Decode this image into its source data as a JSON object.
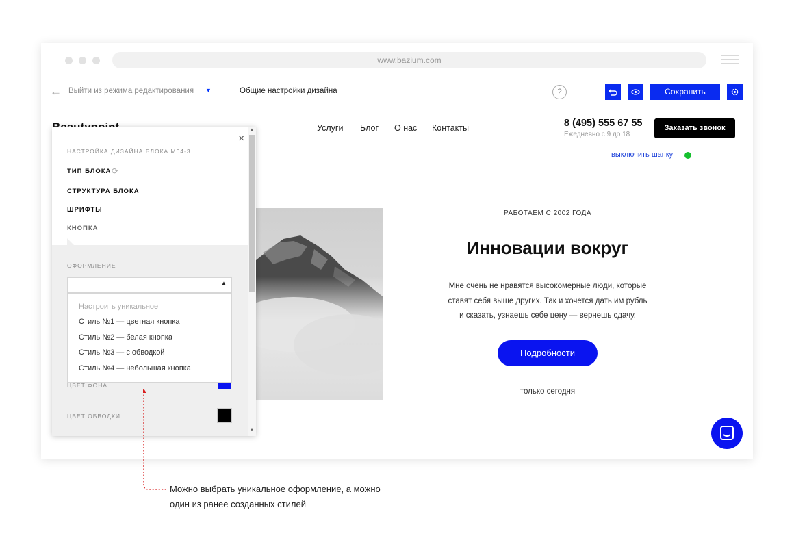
{
  "browser": {
    "url": "www.bazium.com"
  },
  "toolbar": {
    "exit_label": "Выйти из режима редактирования",
    "design_settings_label": "Общие настройки дизайна",
    "help_label": "?",
    "save_label": "Сохранить",
    "accent_color": "#0a2bf0"
  },
  "site_header": {
    "logo": "Beautypoint",
    "nav": [
      "Услуги",
      "Блог",
      "О нас",
      "Контакты"
    ],
    "phone": "8 (495) 555 67 55",
    "hours": "Ежедневно с 9 до 18",
    "call_button": "Заказать звонок",
    "disable_header_link": "выключить шапку"
  },
  "hero": {
    "since": "РАБОТАЕМ С 2002 ГОДА",
    "title": "Инновации вокруг",
    "text_line1": "Мне очень не нравятся высокомерные люди, которые",
    "text_line2": "ставят себя выше других. Так и хочется дать им рубль",
    "text_line3": "и сказать, узнаешь себе цену — вернешь сдачу.",
    "button": "Подробности",
    "only_today": "только сегодня",
    "button_color": "#0a14f0"
  },
  "panel": {
    "title": "НАСТРОЙКА ДИЗАЙНА БЛОКА M04-3",
    "items": [
      "ТИП БЛОКА",
      "СТРУКТУРА БЛОКА",
      "ШРИФТЫ",
      "КНОПКА"
    ],
    "appearance_label": "ОФОРМЛЕНИЕ",
    "dropdown": {
      "placeholder": "Настроить уникальное",
      "options": [
        "Стиль №1 — цветная кнопка",
        "Стиль №2 — белая кнопка",
        "Стиль №3 — с обводкой",
        "Стиль №4 — небольшая кнопка"
      ]
    },
    "bg_color_label": "ЦВЕТ ФОНА",
    "bg_color": "#0a14f0",
    "border_color_label": "ЦВЕТ ОБВОДКИ",
    "border_color": "#000000"
  },
  "annotation": {
    "line1": "Можно выбрать уникальное оформление, а можно",
    "line2": "один из ранее созданных стилей",
    "color": "#d81e1e"
  }
}
